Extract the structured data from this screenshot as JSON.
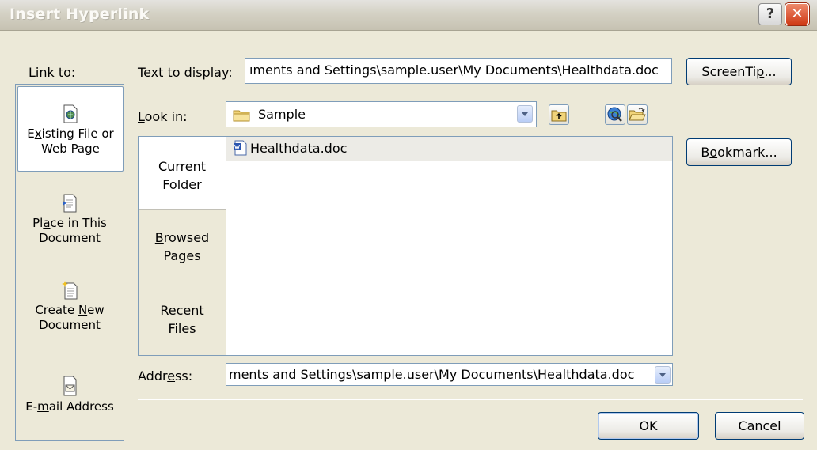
{
  "window": {
    "title": "Insert Hyperlink",
    "help_glyph": "?",
    "close_glyph": "✕"
  },
  "labels": {
    "link_to": "Link to:",
    "text_to_display_pre": "T",
    "text_to_display_post": "ext to display:",
    "look_in_pre": "L",
    "look_in_post": "ook in:",
    "address_pre": "Addr",
    "address_u": "e",
    "address_post": "ss:"
  },
  "fields": {
    "text_to_display": "ıments and Settings\\sample.user\\My Documents\\Healthdata.doc",
    "look_in": "Sample",
    "address": "ments and Settings\\sample.user\\My Documents\\Healthdata.doc"
  },
  "buttons": {
    "screentip_pre": "ScreenTi",
    "screentip_u": "p",
    "screentip_post": "...",
    "bookmark_pre": "B",
    "bookmark_u": "o",
    "bookmark_post": "okmark...",
    "ok": "OK",
    "cancel": "Cancel"
  },
  "link_to": {
    "existing_pre": "E",
    "existing_u": "x",
    "existing_post": "isting File or",
    "existing_line2": "Web Page",
    "place_pre": "Pl",
    "place_u": "a",
    "place_post": "ce in This",
    "place_line2": "Document",
    "create_pre": "Create ",
    "create_u": "N",
    "create_post": "ew",
    "create_line2": "Document",
    "email_pre": "E-",
    "email_u": "m",
    "email_post": "ail Address"
  },
  "browse": {
    "current_pre": "C",
    "current_u": "u",
    "current_post": "rrent",
    "current_line2": "Folder",
    "browsed_u": "B",
    "browsed_post": "rowsed",
    "browsed_line2": "Pages",
    "recent_pre": "Re",
    "recent_u": "c",
    "recent_post": "ent",
    "recent_line2": "Files"
  },
  "files": [
    {
      "name": "Healthdata.doc",
      "icon": "word-document-icon"
    }
  ]
}
